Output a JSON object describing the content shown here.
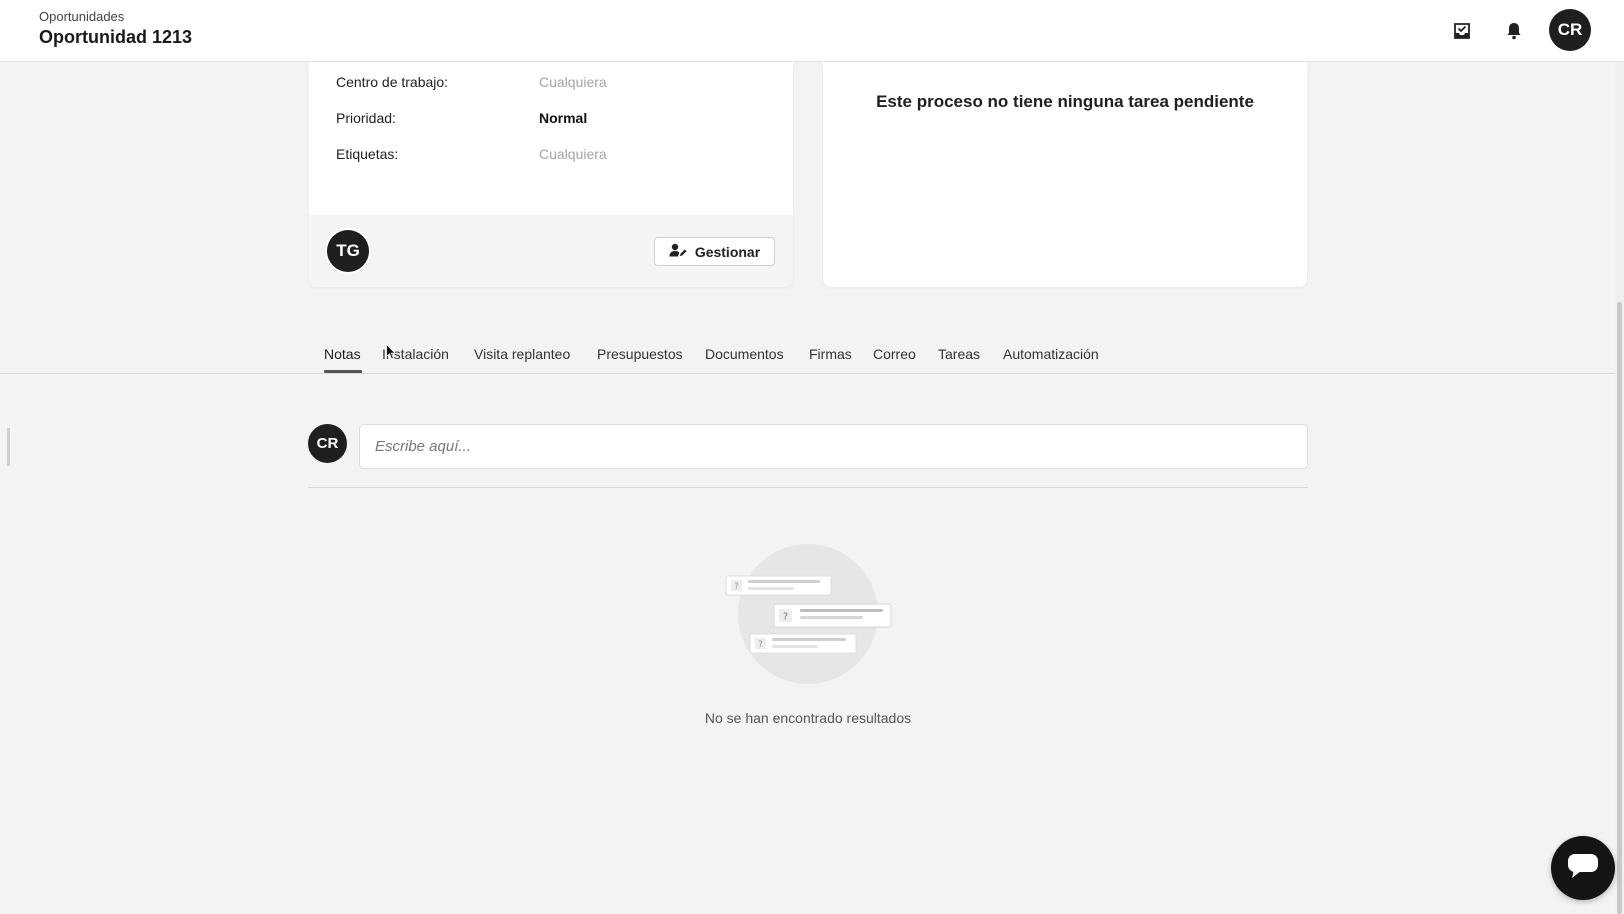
{
  "header": {
    "breadcrumb": "Oportunidades",
    "title": "Oportunidad 1213",
    "user_initials": "CR"
  },
  "info_card": {
    "fields": [
      {
        "label": "Centro de trabajo:",
        "value": "Cualquiera"
      },
      {
        "label": "Prioridad:",
        "value": "Normal"
      },
      {
        "label": "Etiquetas:",
        "value": "Cualquiera"
      }
    ],
    "assignee_initials": "TG",
    "manage_label": "Gestionar"
  },
  "tasks_card": {
    "empty_message": "Este proceso no tiene ninguna tarea pendiente"
  },
  "tabs": [
    {
      "label": "Notas"
    },
    {
      "label": "Instalación"
    },
    {
      "label": "Visita replanteo"
    },
    {
      "label": "Presupuestos"
    },
    {
      "label": "Documentos"
    },
    {
      "label": "Firmas"
    },
    {
      "label": "Correo"
    },
    {
      "label": "Tareas"
    },
    {
      "label": "Automatización"
    }
  ],
  "active_tab": "Notas",
  "notes": {
    "author_initials": "CR",
    "input_placeholder": "Escribe aquí...",
    "empty_message": "No se han encontrado resultados"
  },
  "icons": {
    "inbox": "inbox-check-icon",
    "notifications": "bell-icon",
    "manage": "user-edit-icon",
    "chat": "chat-bubble-icon",
    "empty": "empty-notes-illustration-icon"
  },
  "colors": {
    "avatar_bg": "#1f1f1f",
    "page_bg": "#f3f3f3",
    "card_bg": "#ffffff"
  }
}
